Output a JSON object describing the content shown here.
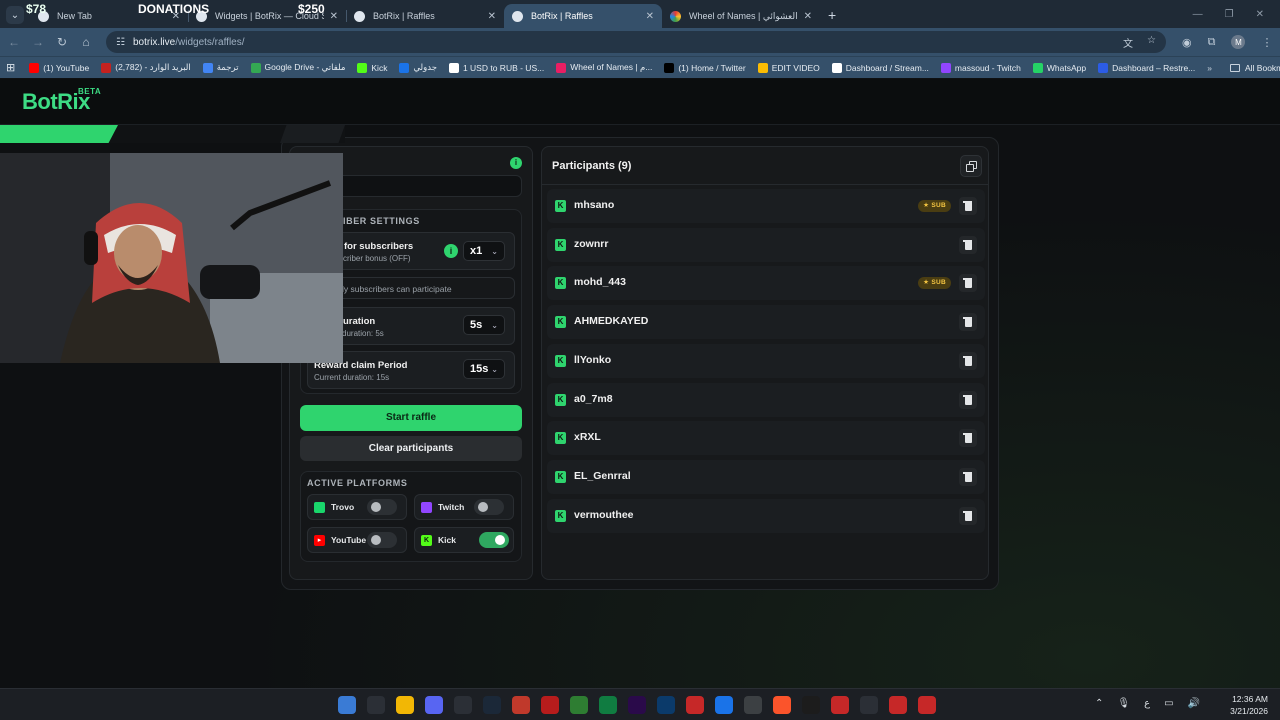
{
  "browser": {
    "tabs": [
      {
        "title": "New Tab",
        "active": false
      },
      {
        "title": "Widgets | BotRix — Cloud Strea",
        "active": false
      },
      {
        "title": "BotRix | Raffles",
        "active": false
      },
      {
        "title": "BotRix | Raffles",
        "active": true
      },
      {
        "title": "Wheel of Names | اسم العشوائي",
        "active": false
      }
    ],
    "window_controls": [
      "—",
      "❐",
      "✕"
    ],
    "url_host": "botrix.live",
    "url_path": "/widgets/raffles/",
    "bookmarks": [
      {
        "label": "(1) YouTube",
        "color": "#ff0000"
      },
      {
        "label": "البريد الوارد - (2,782)",
        "color": "#c5221f"
      },
      {
        "label": "ترجمة",
        "color": "#4285f4"
      },
      {
        "label": "Google Drive - ملفاتي",
        "color": "#34a853"
      },
      {
        "label": "Kick",
        "color": "#53fc18"
      },
      {
        "label": "جدولي",
        "color": "#1a73e8"
      },
      {
        "label": "1 USD to RUB - US...",
        "color": "#ffffff"
      },
      {
        "label": "Wheel of Names | م...",
        "color": "#e91e63"
      },
      {
        "label": "(1) Home / Twitter",
        "color": "#000000"
      },
      {
        "label": "EDIT VIDEO",
        "color": "#fbbc04"
      },
      {
        "label": "Dashboard / Stream...",
        "color": "#ffffff"
      },
      {
        "label": "massoud - Twitch",
        "color": "#9146ff"
      },
      {
        "label": "WhatsApp",
        "color": "#25d366"
      },
      {
        "label": "Dashboard – Restre...",
        "color": "#2c5ce6"
      }
    ],
    "all_bookmarks": "All Bookmarks"
  },
  "page": {
    "logo": "BotRix",
    "logo_badge": "BETA",
    "donations": {
      "left_amount": "$78",
      "label": "DONATIONS",
      "right_amount": "$250"
    },
    "settings": {
      "info_icon": "i",
      "subscriber_heading": "IBER SETTINGS",
      "bonus_title": "for subscribers",
      "bonus_sub": "criber bonus (OFF)",
      "bonus_value": "x1",
      "only_subs": "ly subscribers can participate",
      "duration_title": "uration",
      "duration_sub": "duration: 5s",
      "duration_value": "5s",
      "claim_title": "Reward claim Period",
      "claim_sub": "Current duration: 15s",
      "claim_value": "15s"
    },
    "start_button": "Start raffle",
    "clear_button": "Clear participants",
    "platforms_heading": "ACTIVE PLATFORMS",
    "platforms": [
      {
        "name": "Trovo",
        "enabled": false,
        "color": "#19d66b"
      },
      {
        "name": "Twitch",
        "enabled": false,
        "color": "#9146ff"
      },
      {
        "name": "YouTube",
        "enabled": false,
        "color": "#ff0000"
      },
      {
        "name": "Kick",
        "enabled": true,
        "color": "#53fc18"
      }
    ],
    "participants_title": "Participants (9)",
    "participants": [
      {
        "name": "mhsano",
        "badge": "SUB"
      },
      {
        "name": "zownrr",
        "badge": ""
      },
      {
        "name": "mohd_443",
        "badge": "SUB"
      },
      {
        "name": "AHMEDKAYED",
        "badge": ""
      },
      {
        "name": "llYonko",
        "badge": ""
      },
      {
        "name": "a0_7m8",
        "badge": ""
      },
      {
        "name": "xRXL",
        "badge": ""
      },
      {
        "name": "EL_Genrral",
        "badge": ""
      },
      {
        "name": "vermouthee",
        "badge": ""
      }
    ]
  },
  "taskbar": {
    "time": "12:36 AM",
    "date": "3/21/2026",
    "lang": "ع"
  },
  "colors": {
    "accent": "#2fd46e",
    "sub_badge": "#f4c542"
  }
}
